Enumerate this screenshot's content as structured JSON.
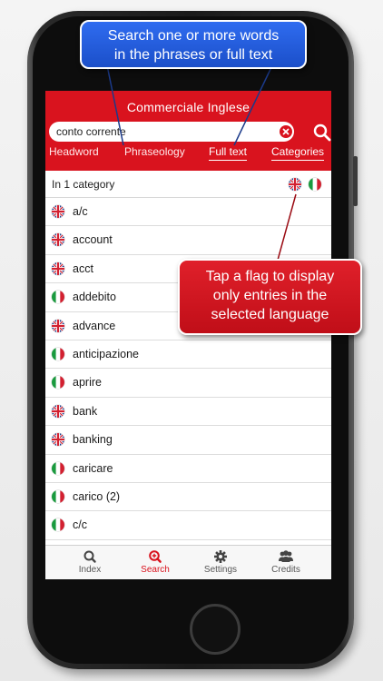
{
  "app": {
    "title": "Commerciale Inglese"
  },
  "search": {
    "value": "conto corrente"
  },
  "mode_tabs": [
    {
      "label": "Headword",
      "active": false
    },
    {
      "label": "Phraseology",
      "active": false
    },
    {
      "label": "Full text",
      "active": true
    },
    {
      "label": "Categories",
      "active": true
    }
  ],
  "category_row": {
    "label": "In 1 category",
    "flags": [
      "uk-flag",
      "italy-flag"
    ]
  },
  "entries": [
    {
      "word": "a/c",
      "flag": "uk-flag"
    },
    {
      "word": "account",
      "flag": "uk-flag"
    },
    {
      "word": "acct",
      "flag": "uk-flag"
    },
    {
      "word": "addebito",
      "flag": "italy-flag"
    },
    {
      "word": "advance",
      "flag": "uk-flag"
    },
    {
      "word": "anticipazione",
      "flag": "italy-flag"
    },
    {
      "word": "aprire",
      "flag": "italy-flag"
    },
    {
      "word": "bank",
      "flag": "uk-flag"
    },
    {
      "word": "banking",
      "flag": "uk-flag"
    },
    {
      "word": "caricare",
      "flag": "italy-flag"
    },
    {
      "word": "carico (2)",
      "flag": "italy-flag"
    },
    {
      "word": "c/c",
      "flag": "italy-flag"
    }
  ],
  "tabbar": [
    {
      "label": "Index",
      "icon": "search-icon",
      "active": false
    },
    {
      "label": "Search",
      "icon": "zoom-in-icon",
      "active": true
    },
    {
      "label": "Settings",
      "icon": "gear-icon",
      "active": false
    },
    {
      "label": "Credits",
      "icon": "users-icon",
      "active": false
    }
  ],
  "callouts": {
    "top_line1": "Search one or more words",
    "top_line2": "in the phrases or full text",
    "right_line1": "Tap a flag to display",
    "right_line2": "only entries in the",
    "right_line3": "selected language"
  },
  "colors": {
    "accent": "#d9131e",
    "callout_blue": "#1b4fc9",
    "callout_red": "#c00e18"
  }
}
